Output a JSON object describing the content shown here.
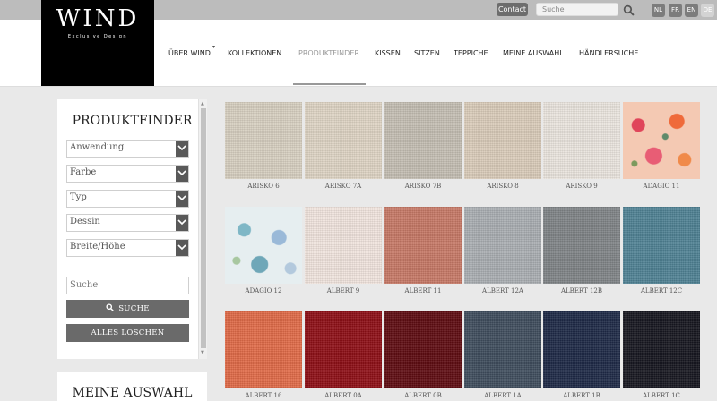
{
  "topbar": {
    "contact_label": "Contact",
    "search_placeholder": "Suche",
    "languages": [
      {
        "code": "NL",
        "active": false
      },
      {
        "code": "FR",
        "active": false
      },
      {
        "code": "EN",
        "active": false
      },
      {
        "code": "DE",
        "active": true
      }
    ]
  },
  "logo": {
    "main": "WIND",
    "sub": "Exclusive Design"
  },
  "nav": [
    {
      "label": "ÜBER WIND",
      "active": false
    },
    {
      "label": "KOLLEKTIONEN",
      "active": false
    },
    {
      "label": "PRODUKTFINDER",
      "active": true
    },
    {
      "label": "KISSEN",
      "active": false
    },
    {
      "label": "SITZEN",
      "active": false
    },
    {
      "label": "TEPPICHE",
      "active": false
    },
    {
      "label": "MEINE AUSWAHL",
      "active": false
    },
    {
      "label": "HÄNDLERSUCHE",
      "active": false
    }
  ],
  "sidebar": {
    "title": "PRODUKTFINDER",
    "filters": [
      "Anwendung",
      "Farbe",
      "Typ",
      "Dessin",
      "Breite/Höhe"
    ],
    "search_placeholder": "Suche",
    "search_button": "SUCHE",
    "clear_button": "ALLES LÖSCHEN"
  },
  "sidebar2": {
    "title": "MEINE AUSWAHL"
  },
  "products": [
    {
      "name": "ARISKO 6",
      "color": "#d6cfc0"
    },
    {
      "name": "ARISKO 7A",
      "color": "#ddd3c3"
    },
    {
      "name": "ARISKO 7B",
      "color": "#c3bdb2"
    },
    {
      "name": "ARISKO 8",
      "color": "#d9cbb9"
    },
    {
      "name": "ARISKO 9",
      "color": "#e9e4dd"
    },
    {
      "name": "ADAGIO 11",
      "color": "#f4c9b3"
    },
    {
      "name": "ADAGIO 12",
      "color": "#e6eef0"
    },
    {
      "name": "ALBERT 9",
      "color": "#efe3dc"
    },
    {
      "name": "ALBERT 11",
      "color": "#c57866"
    },
    {
      "name": "ALBERT 12A",
      "color": "#a9adb1"
    },
    {
      "name": "ALBERT 12B",
      "color": "#7f8386"
    },
    {
      "name": "ALBERT 12C",
      "color": "#4f8193"
    },
    {
      "name": "ALBERT 16",
      "color": "#df6a48"
    },
    {
      "name": "ALBERT 0A",
      "color": "#8d0f16"
    },
    {
      "name": "ALBERT 0B",
      "color": "#5e0c12"
    },
    {
      "name": "ALBERT 1A",
      "color": "#3f4d5d"
    },
    {
      "name": "ALBERT 1B",
      "color": "#1f2a47"
    },
    {
      "name": "ALBERT 1C",
      "color": "#171720"
    }
  ]
}
